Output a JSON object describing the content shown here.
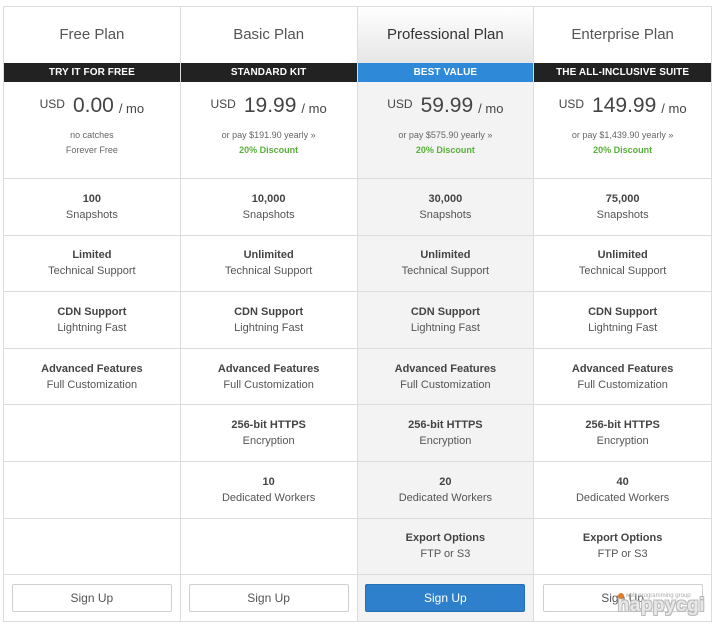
{
  "plans": [
    {
      "name": "Free Plan",
      "tagline": "TRY IT FOR FREE",
      "currency": "USD",
      "price": "0.00",
      "period": "/ mo",
      "note": "no catches",
      "note2": "Forever Free",
      "discount": "",
      "features": [
        {
          "title": "100",
          "sub": "Snapshots"
        },
        {
          "title": "Limited",
          "sub": "Technical Support"
        },
        {
          "title": "CDN Support",
          "sub": "Lightning Fast"
        },
        {
          "title": "Advanced Features",
          "sub": "Full Customization"
        },
        {
          "title": "",
          "sub": ""
        },
        {
          "title": "",
          "sub": ""
        },
        {
          "title": "",
          "sub": ""
        }
      ],
      "button": "Sign Up"
    },
    {
      "name": "Basic Plan",
      "tagline": "STANDARD KIT",
      "currency": "USD",
      "price": "19.99",
      "period": "/ mo",
      "note": "or pay $191.90 yearly »",
      "note2": "",
      "discount": "20% Discount",
      "features": [
        {
          "title": "10,000",
          "sub": "Snapshots"
        },
        {
          "title": "Unlimited",
          "sub": "Technical Support"
        },
        {
          "title": "CDN Support",
          "sub": "Lightning Fast"
        },
        {
          "title": "Advanced Features",
          "sub": "Full Customization"
        },
        {
          "title": "256-bit HTTPS",
          "sub": "Encryption"
        },
        {
          "title": "10",
          "sub": "Dedicated Workers"
        },
        {
          "title": "",
          "sub": ""
        }
      ],
      "button": "Sign Up"
    },
    {
      "name": "Professional Plan",
      "tagline": "BEST VALUE",
      "currency": "USD",
      "price": "59.99",
      "period": "/ mo",
      "note": "or pay $575.90 yearly »",
      "note2": "",
      "discount": "20% Discount",
      "features": [
        {
          "title": "30,000",
          "sub": "Snapshots"
        },
        {
          "title": "Unlimited",
          "sub": "Technical Support"
        },
        {
          "title": "CDN Support",
          "sub": "Lightning Fast"
        },
        {
          "title": "Advanced Features",
          "sub": "Full Customization"
        },
        {
          "title": "256-bit HTTPS",
          "sub": "Encryption"
        },
        {
          "title": "20",
          "sub": "Dedicated Workers"
        },
        {
          "title": "Export Options",
          "sub": "FTP or S3"
        }
      ],
      "button": "Sign Up"
    },
    {
      "name": "Enterprise Plan",
      "tagline": "THE ALL-INCLUSIVE SUITE",
      "currency": "USD",
      "price": "149.99",
      "period": "/ mo",
      "note": "or pay $1,439.90 yearly »",
      "note2": "",
      "discount": "20% Discount",
      "features": [
        {
          "title": "75,000",
          "sub": "Snapshots"
        },
        {
          "title": "Unlimited",
          "sub": "Technical Support"
        },
        {
          "title": "CDN Support",
          "sub": "Lightning Fast"
        },
        {
          "title": "Advanced Features",
          "sub": "Full Customization"
        },
        {
          "title": "256-bit HTTPS",
          "sub": "Encryption"
        },
        {
          "title": "40",
          "sub": "Dedicated Workers"
        },
        {
          "title": "Export Options",
          "sub": "FTP or S3"
        }
      ],
      "button": "Sign Up"
    }
  ],
  "watermark": {
    "small": "web programming group",
    "big": "happycgi"
  },
  "colors": {
    "accent": "#2e8ad8",
    "band": "#222222",
    "discount": "#58b13a",
    "primary_button": "#2e80cc"
  }
}
